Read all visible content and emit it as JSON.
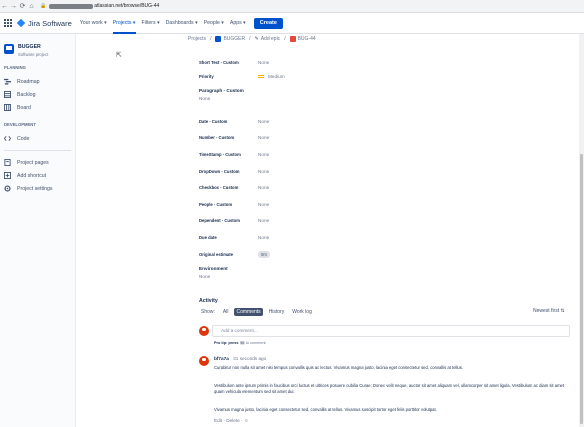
{
  "browser": {
    "url_text": "atlassian.net/browse/BUG-44",
    "back": "←",
    "forward": "→",
    "reload": "⟳",
    "home": "⌂",
    "lock": "🔒"
  },
  "appbar": {
    "logo": "Jira Software",
    "nav": [
      "Your work ▾",
      "Projects ▾",
      "Filters ▾",
      "Dashboards ▾",
      "People ▾",
      "Apps ▾"
    ],
    "create": "Create"
  },
  "sidebar": {
    "project_name": "BUGGER",
    "project_type": "Software project",
    "planning": "PLANNING",
    "roadmap": "Roadmap",
    "backlog": "Backlog",
    "board": "Board",
    "development": "DEVELOPMENT",
    "code": "Code",
    "project_pages": "Project pages",
    "add_shortcut": "Add shortcut",
    "project_settings": "Project settings"
  },
  "breadcrumb": {
    "projects": "Projects",
    "sep": "/",
    "project": "BUGGER",
    "add_epic": "Add epic",
    "issue": "BUG-44"
  },
  "fields": {
    "short_text": {
      "label": "Short Text - Custom",
      "value": "None"
    },
    "priority": {
      "label": "Priority",
      "value": "Medium"
    },
    "paragraph": {
      "label": "Paragraph - Custom",
      "value": "None"
    },
    "date": {
      "label": "Date - Custom",
      "value": "None"
    },
    "number": {
      "label": "Number - Custom",
      "value": "None"
    },
    "timestamp": {
      "label": "TimeStamp - Custom",
      "value": "None"
    },
    "dropdown": {
      "label": "DropDown - Custom",
      "value": "None"
    },
    "checkbox": {
      "label": "Checkbox - Custom",
      "value": "None"
    },
    "people": {
      "label": "People - Custom",
      "value": "None"
    },
    "dependent": {
      "label": "Dependent - Custom",
      "value": "None"
    },
    "due_date": {
      "label": "Due date",
      "value": "None"
    },
    "original_estimate": {
      "label": "Original estimate",
      "value": "0m"
    },
    "environment": {
      "label": "Environment",
      "value": "None"
    }
  },
  "activity": {
    "title": "Activity",
    "show": "Show:",
    "tabs": [
      "All",
      "Comments",
      "History",
      "Work log"
    ],
    "newest": "Newest first ⇅",
    "placeholder": "Add a comment...",
    "protip_prefix": "Pro tip: press",
    "protip_key": "M",
    "protip_suffix": "to comment"
  },
  "comment": {
    "author": "bf7a7a",
    "time": "31 seconds ago",
    "p1": "Curabitur non nulla sit amet nisi tempus convallis quis ac lectus. Vivamus magna justo, lacinia eget consectetur sed, convallis at tellus.",
    "p2": "Vestibulum ante ipsum primis in faucibus orci luctus et ultrices posuere cubilia Curae; Donec velit neque, auctor sit amet aliquam vel, ullamcorper sit amet ligula. Vestibulum ac diam sit amet quam vehicula elementum sed sit amet dui.",
    "p3": "Vivamus magna justo, lacinia eget consectetur sed, convallis at tellus. Vivamus suscipit tortor eget felis porttitor volutpat.",
    "actions": "Edit · Delete · ☺"
  },
  "colors": {
    "brand": "#0052cc",
    "priority_medium": "#ffab00",
    "avatar": "#de350b"
  }
}
